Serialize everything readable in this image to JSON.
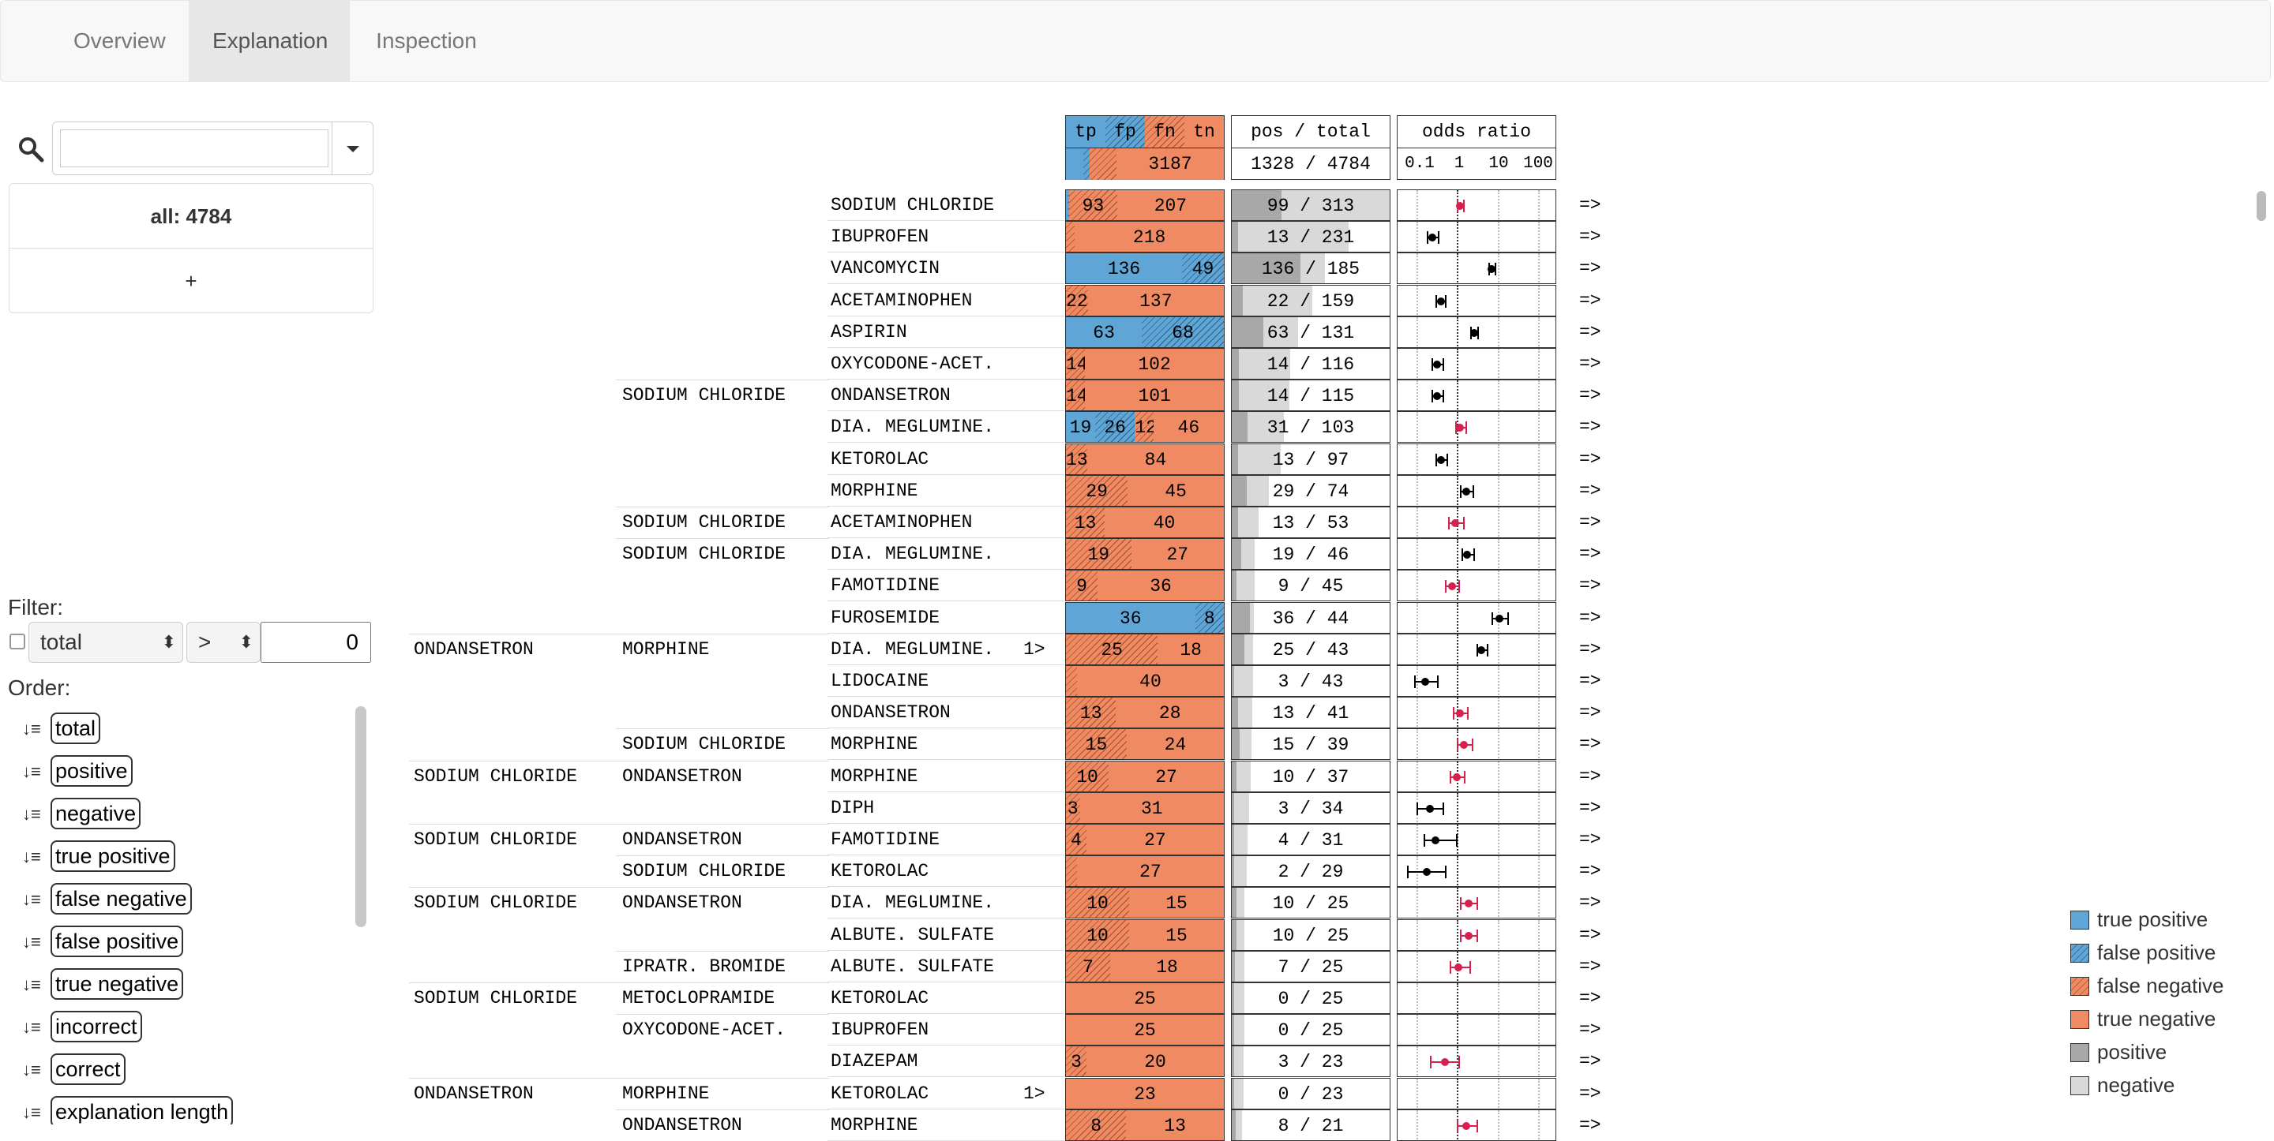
{
  "tabs": [
    {
      "label": "Overview",
      "active": false
    },
    {
      "label": "Explanation",
      "active": true
    },
    {
      "label": "Inspection",
      "active": false
    }
  ],
  "search": {
    "value": "",
    "placeholder": ""
  },
  "groups": {
    "all_label": "all: 4784",
    "add_label": "+"
  },
  "filter": {
    "label": "Filter:",
    "field": "total",
    "operator": ">",
    "value": "0",
    "enabled": false
  },
  "order": {
    "label": "Order:",
    "items": [
      "total",
      "positive",
      "negative",
      "true positive",
      "false negative",
      "false positive",
      "true negative",
      "incorrect",
      "correct",
      "explanation length"
    ]
  },
  "header": {
    "confusion_labels": [
      "tp",
      "fp",
      "fn",
      "tn"
    ],
    "confusion_total": {
      "tp": 0.03,
      "fp": 0.05,
      "fn": 0.13,
      "tn": 3187,
      "tn_label": "3187"
    },
    "pos_total_title": "pos / total",
    "pos_total_value": "1328 / 4784",
    "pos_fraction": 0.28,
    "odds_title": "odds ratio",
    "odds_ticks": [
      "0.1",
      "1",
      "10",
      "100"
    ]
  },
  "colors": {
    "true_positive": "#5fa6d6",
    "false_negative": "#ef8a62",
    "positive": "#a8a8a8",
    "negative": "#d9d9d9",
    "odds_significant": "#d6204e",
    "odds_default": "#000000"
  },
  "rows": [
    {
      "c1": "",
      "c2": "",
      "c3": "SODIUM CHLORIDE",
      "mark": "",
      "tp": 3,
      "fp": 3,
      "fn": 93,
      "tn": 207,
      "pos": 99,
      "total": 313,
      "or": [
        1.2,
        1.0,
        1.4
      ],
      "sig": true,
      "arrow": "=>"
    },
    {
      "c1": "",
      "c2": "",
      "c3": "IBUPROFEN",
      "mark": "",
      "tp": 0,
      "fp": 0,
      "fn": 13,
      "tn": 218,
      "pos": 13,
      "total": 231,
      "or": [
        0.25,
        0.18,
        0.34
      ],
      "sig": false,
      "arrow": "=>"
    },
    {
      "c1": "",
      "c2": "",
      "c3": "VANCOMYCIN",
      "mark": "",
      "tp": 136,
      "fp": 49,
      "fn": 0,
      "tn": 0,
      "pos": 136,
      "total": 185,
      "or": [
        7,
        6,
        8.5
      ],
      "sig": false,
      "arrow": "=>"
    },
    {
      "c1": "",
      "c2": "",
      "c3": "ACETAMINOPHEN",
      "mark": "",
      "tp": 0,
      "fp": 0,
      "fn": 22,
      "tn": 137,
      "pos": 22,
      "total": 159,
      "or": [
        0.4,
        0.3,
        0.5
      ],
      "sig": false,
      "arrow": "=>"
    },
    {
      "c1": "",
      "c2": "",
      "c3": "ASPIRIN",
      "mark": "",
      "tp": 63,
      "fp": 68,
      "fn": 0,
      "tn": 0,
      "pos": 63,
      "total": 131,
      "or": [
        2.6,
        2.1,
        3.2
      ],
      "sig": false,
      "arrow": "=>"
    },
    {
      "c1": "",
      "c2": "",
      "c3": "OXYCODONE-ACET.",
      "mark": "",
      "tp": 0,
      "fp": 0,
      "fn": 14,
      "tn": 102,
      "pos": 14,
      "total": 116,
      "or": [
        0.33,
        0.24,
        0.45
      ],
      "sig": false,
      "arrow": "=>"
    },
    {
      "c1": "",
      "c2": "SODIUM CHLORIDE",
      "c3": "ONDANSETRON",
      "mark": "",
      "tp": 0,
      "fp": 0,
      "fn": 14,
      "tn": 101,
      "pos": 14,
      "total": 115,
      "or": [
        0.33,
        0.24,
        0.45
      ],
      "sig": false,
      "arrow": "=>"
    },
    {
      "c1": "",
      "c2": "",
      "c3": "DIA. MEGLUMINE.",
      "mark": "",
      "tp": 19,
      "fp": 26,
      "fn": 12,
      "tn": 46,
      "pos": 31,
      "total": 103,
      "or": [
        1.2,
        0.9,
        1.6
      ],
      "sig": true,
      "arrow": "=>"
    },
    {
      "c1": "",
      "c2": "",
      "c3": "KETOROLAC",
      "mark": "",
      "tp": 0,
      "fp": 0,
      "fn": 13,
      "tn": 84,
      "pos": 13,
      "total": 97,
      "or": [
        0.4,
        0.3,
        0.55
      ],
      "sig": false,
      "arrow": "=>"
    },
    {
      "c1": "",
      "c2": "",
      "c3": "MORPHINE",
      "mark": "",
      "tp": 0,
      "fp": 0,
      "fn": 29,
      "tn": 45,
      "pos": 29,
      "total": 74,
      "or": [
        1.7,
        1.2,
        2.4
      ],
      "sig": false,
      "arrow": "=>"
    },
    {
      "c1": "",
      "c2": "SODIUM CHLORIDE",
      "c3": "ACETAMINOPHEN",
      "mark": "",
      "tp": 0,
      "fp": 0,
      "fn": 13,
      "tn": 40,
      "pos": 13,
      "total": 53,
      "or": [
        0.9,
        0.6,
        1.4
      ],
      "sig": true,
      "arrow": "=>"
    },
    {
      "c1": "",
      "c2": "SODIUM CHLORIDE",
      "c3": "DIA. MEGLUMINE.",
      "mark": "",
      "tp": 0,
      "fp": 0,
      "fn": 19,
      "tn": 27,
      "pos": 19,
      "total": 46,
      "or": [
        1.8,
        1.3,
        2.5
      ],
      "sig": false,
      "arrow": "=>"
    },
    {
      "c1": "",
      "c2": "",
      "c3": "FAMOTIDINE",
      "mark": "",
      "tp": 0,
      "fp": 0,
      "fn": 9,
      "tn": 36,
      "pos": 9,
      "total": 45,
      "or": [
        0.75,
        0.5,
        1.1
      ],
      "sig": true,
      "arrow": "=>"
    },
    {
      "c1": "",
      "c2": "",
      "c3": "FUROSEMIDE",
      "mark": "",
      "tp": 36,
      "fp": 8,
      "fn": 0,
      "tn": 0,
      "pos": 36,
      "total": 44,
      "or": [
        11,
        7,
        17
      ],
      "sig": false,
      "arrow": "=>"
    },
    {
      "c1": "ONDANSETRON",
      "c2": "MORPHINE",
      "c3": "DIA. MEGLUMINE.",
      "mark": "1>",
      "tp": 0,
      "fp": 0,
      "fn": 25,
      "tn": 18,
      "pos": 25,
      "total": 43,
      "or": [
        4,
        3,
        5.5
      ],
      "sig": false,
      "arrow": "=>"
    },
    {
      "c1": "",
      "c2": "",
      "c3": "LIDOCAINE",
      "mark": "",
      "tp": 0,
      "fp": 0,
      "fn": 3,
      "tn": 40,
      "pos": 3,
      "total": 43,
      "or": [
        0.17,
        0.09,
        0.32
      ],
      "sig": false,
      "arrow": "=>"
    },
    {
      "c1": "",
      "c2": "",
      "c3": "ONDANSETRON",
      "mark": "",
      "tp": 0,
      "fp": 0,
      "fn": 13,
      "tn": 28,
      "pos": 13,
      "total": 41,
      "or": [
        1.2,
        0.8,
        1.8
      ],
      "sig": true,
      "arrow": "=>"
    },
    {
      "c1": "",
      "c2": "SODIUM CHLORIDE",
      "c3": "MORPHINE",
      "mark": "",
      "tp": 0,
      "fp": 0,
      "fn": 15,
      "tn": 24,
      "pos": 15,
      "total": 39,
      "or": [
        1.5,
        1.0,
        2.3
      ],
      "sig": true,
      "arrow": "=>"
    },
    {
      "c1": "SODIUM CHLORIDE",
      "c2": "ONDANSETRON",
      "c3": "MORPHINE",
      "mark": "",
      "tp": 0,
      "fp": 0,
      "fn": 10,
      "tn": 27,
      "pos": 10,
      "total": 37,
      "or": [
        1.0,
        0.65,
        1.5
      ],
      "sig": true,
      "arrow": "=>"
    },
    {
      "c1": "",
      "c2": "",
      "c3": "DIPH",
      "mark": "",
      "tp": 0,
      "fp": 0,
      "fn": 3,
      "tn": 31,
      "pos": 3,
      "total": 34,
      "or": [
        0.22,
        0.1,
        0.45
      ],
      "sig": false,
      "arrow": "=>"
    },
    {
      "c1": "SODIUM CHLORIDE",
      "c2": "ONDANSETRON",
      "c3": "FAMOTIDINE",
      "mark": "",
      "tp": 0,
      "fp": 0,
      "fn": 4,
      "tn": 27,
      "pos": 4,
      "total": 31,
      "or": [
        0.3,
        0.15,
        0.95
      ],
      "sig": false,
      "arrow": "=>"
    },
    {
      "c1": "",
      "c2": "SODIUM CHLORIDE",
      "c3": "KETOROLAC",
      "mark": "",
      "tp": 0,
      "fp": 0,
      "fn": 2,
      "tn": 27,
      "pos": 2,
      "total": 29,
      "or": [
        0.18,
        0.06,
        0.5
      ],
      "sig": false,
      "arrow": "=>"
    },
    {
      "c1": "SODIUM CHLORIDE",
      "c2": "ONDANSETRON",
      "c3": "DIA. MEGLUMINE.",
      "mark": "",
      "tp": 0,
      "fp": 0,
      "fn": 10,
      "tn": 15,
      "pos": 10,
      "total": 25,
      "or": [
        1.9,
        1.2,
        3.0
      ],
      "sig": true,
      "arrow": "=>"
    },
    {
      "c1": "",
      "c2": "",
      "c3": "ALBUTE. SULFATE",
      "mark": "",
      "tp": 0,
      "fp": 0,
      "fn": 10,
      "tn": 15,
      "pos": 10,
      "total": 25,
      "or": [
        1.9,
        1.2,
        3.0
      ],
      "sig": true,
      "arrow": "=>"
    },
    {
      "c1": "",
      "c2": "IPRATR. BROMIDE",
      "c3": "ALBUTE. SULFATE",
      "mark": "",
      "tp": 0,
      "fp": 0,
      "fn": 7,
      "tn": 18,
      "pos": 7,
      "total": 25,
      "or": [
        1.1,
        0.65,
        2.0
      ],
      "sig": true,
      "arrow": "=>"
    },
    {
      "c1": "SODIUM CHLORIDE",
      "c2": "METOCLOPRAMIDE",
      "c3": "KETOROLAC",
      "mark": "",
      "tp": 0,
      "fp": 0,
      "fn": 0,
      "tn": 25,
      "pos": 0,
      "total": 25,
      "or": null,
      "sig": false,
      "arrow": "=>"
    },
    {
      "c1": "",
      "c2": "OXYCODONE-ACET.",
      "c3": "IBUPROFEN",
      "mark": "",
      "tp": 0,
      "fp": 0,
      "fn": 0,
      "tn": 25,
      "pos": 0,
      "total": 25,
      "or": null,
      "sig": false,
      "arrow": "=>"
    },
    {
      "c1": "",
      "c2": "",
      "c3": "DIAZEPAM",
      "mark": "",
      "tp": 0,
      "fp": 0,
      "fn": 3,
      "tn": 20,
      "pos": 3,
      "total": 23,
      "or": [
        0.5,
        0.22,
        1.1
      ],
      "sig": true,
      "arrow": "=>"
    },
    {
      "c1": "ONDANSETRON",
      "c2": "MORPHINE",
      "c3": "KETOROLAC",
      "mark": "1>",
      "tp": 0,
      "fp": 0,
      "fn": 0,
      "tn": 23,
      "pos": 0,
      "total": 23,
      "or": null,
      "sig": false,
      "arrow": "=>"
    },
    {
      "c1": "",
      "c2": "ONDANSETRON",
      "c3": "MORPHINE",
      "mark": "",
      "tp": 0,
      "fp": 0,
      "fn": 8,
      "tn": 13,
      "pos": 8,
      "total": 21,
      "or": [
        1.7,
        1.0,
        3.0
      ],
      "sig": true,
      "arrow": "=>"
    }
  ],
  "legend": [
    "true positive",
    "false positive",
    "false negative",
    "true negative",
    "positive",
    "negative"
  ]
}
